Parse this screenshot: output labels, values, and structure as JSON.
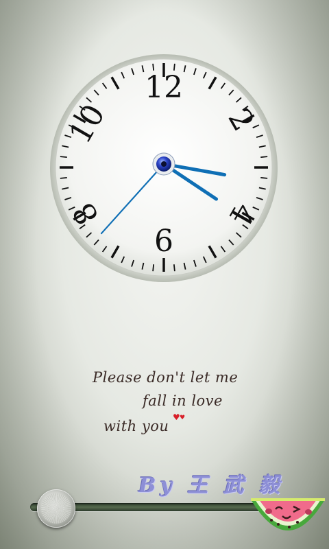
{
  "clock": {
    "numerals": [
      "12",
      "2",
      "4",
      "6",
      "8",
      "10"
    ],
    "time": {
      "hour": 3,
      "minute": 20,
      "second": 37
    },
    "colors": {
      "hands": "#0f6fb5",
      "center": "#1d2f9a",
      "ticks": "#111111"
    }
  },
  "quote": {
    "line1": "Please don't let me",
    "line2": "fall in love",
    "line3": "with you"
  },
  "signature": "By 王 武 毅",
  "unlock": {
    "state": "locked"
  },
  "icons": {
    "heart": "heart-icon",
    "melon": "watermelon-icon",
    "knob": "slider-knob-icon"
  }
}
